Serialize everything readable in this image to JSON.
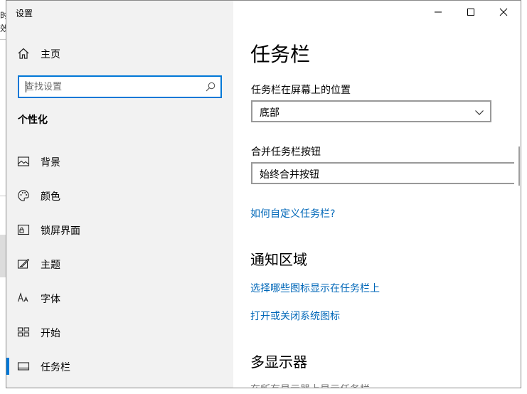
{
  "background_window": {
    "fragment_top": "时",
    "fragment_mid": "效"
  },
  "window": {
    "title": "设置",
    "controls": {
      "minimize": "—",
      "maximize": "☐",
      "close": "✕"
    }
  },
  "sidebar": {
    "home_label": "主页",
    "search_placeholder": "查找设置",
    "section_title": "个性化",
    "items": [
      {
        "label": "背景",
        "icon": "picture-icon"
      },
      {
        "label": "颜色",
        "icon": "palette-icon"
      },
      {
        "label": "锁屏界面",
        "icon": "lock-screen-icon"
      },
      {
        "label": "主题",
        "icon": "theme-icon"
      },
      {
        "label": "字体",
        "icon": "font-icon"
      },
      {
        "label": "开始",
        "icon": "start-icon"
      },
      {
        "label": "任务栏",
        "icon": "taskbar-icon",
        "selected": true
      }
    ]
  },
  "main": {
    "title": "任务栏",
    "position_label": "任务栏在屏幕上的位置",
    "position_value": "底部",
    "combine_label": "合并任务栏按钮",
    "combine_value": "始终合并按钮",
    "customize_link": "如何自定义任务栏?",
    "notify_heading": "通知区域",
    "notify_link1": "选择哪些图标显示在任务栏上",
    "notify_link2": "打开或关闭系统图标",
    "multi_heading": "多显示器",
    "multi_cut_text": "在所有显示器上显示任务栏"
  },
  "colors": {
    "accent": "#0078d7",
    "link": "#0067b8",
    "sidebar_bg": "#f2f2f2"
  }
}
